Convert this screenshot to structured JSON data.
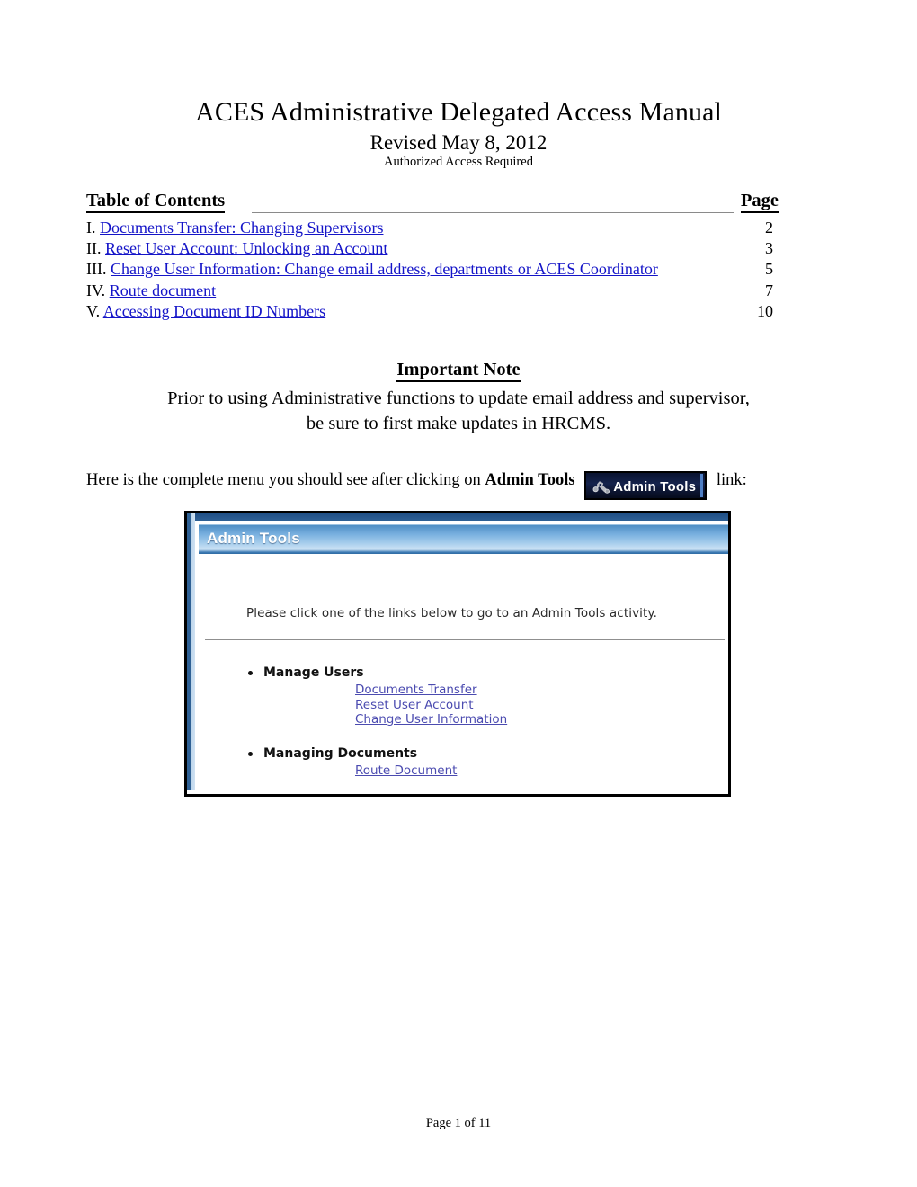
{
  "document": {
    "title": "ACES Administrative Delegated Access Manual",
    "revision": "Revised May 8, 2012",
    "access_note": "Authorized Access Required",
    "footer": "Page 1 of 11"
  },
  "toc": {
    "heading": "Table of Contents",
    "page_column_heading": "Page",
    "link_color": "#1414c8",
    "entries": [
      {
        "numeral": "I.",
        "label": "Documents Transfer:  Changing Supervisors",
        "page": "2"
      },
      {
        "numeral": "II.",
        "label": "Reset User Account: Unlocking an Account",
        "page": "3"
      },
      {
        "numeral": "III.",
        "label": "Change User Information:  Change email address, departments or ACES Coordinator",
        "page": "5"
      },
      {
        "numeral": "IV.",
        "label": "Route document",
        "page": "7"
      },
      {
        "numeral": "V.",
        "label": "Accessing Document ID Numbers",
        "page": "10"
      }
    ]
  },
  "important_note": {
    "heading": "Important Note",
    "line1": "Prior to using Administrative functions to update email address and supervisor,",
    "line2": "be sure to first make updates in HRCMS."
  },
  "intro": {
    "before_badge": "Here is the complete menu you should see after clicking on ",
    "bold_label": "Admin Tools",
    "after_badge": "link:",
    "badge_label": "Admin Tools",
    "badge_bg": "#14224c",
    "badge_text_color": "#ffffff"
  },
  "panel": {
    "header_title": "Admin Tools",
    "header_accent": "#76aede",
    "instruction": "Please click one of the links below to go to an Admin Tools activity.",
    "link_color": "#4b4bb0",
    "groups": [
      {
        "title": "Manage Users",
        "links": [
          "Documents Transfer",
          "Reset User Account",
          "Change User Information"
        ]
      },
      {
        "title": "Managing Documents",
        "links": [
          "Route Document"
        ]
      }
    ]
  }
}
